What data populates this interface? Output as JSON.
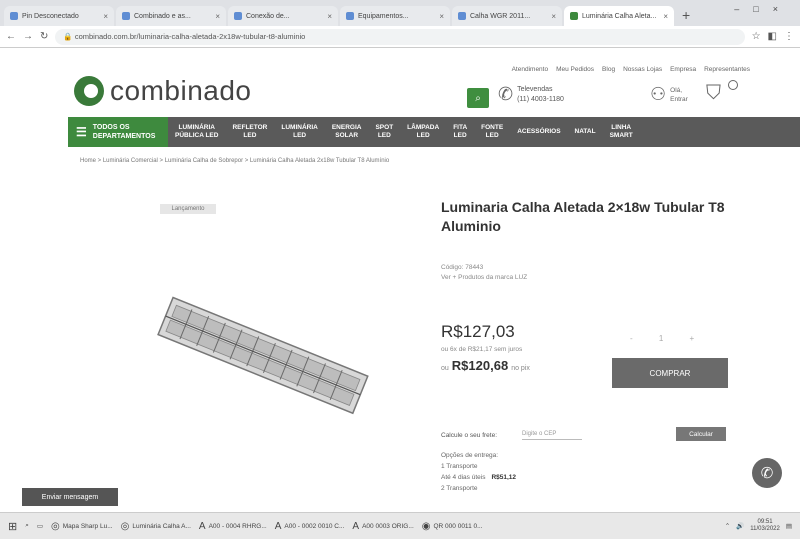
{
  "browser": {
    "tabs": [
      {
        "label": "Pin Desconectado"
      },
      {
        "label": "Combinado e as..."
      },
      {
        "label": "Conexão de..."
      },
      {
        "label": "Equipamentos..."
      },
      {
        "label": "Calha WGR 2011..."
      },
      {
        "label": "Luminária Calha Aleta...",
        "active": true
      }
    ],
    "new_tab": "+",
    "url": "combinado.com.br/luminaria-calha-aletada-2x18w-tubular-t8-aluminio"
  },
  "site": {
    "logo_text": "combinado",
    "top_links": [
      "Atendimento",
      "Meu Pedidos",
      "Blog",
      "Nossas Lojas",
      "Empresa",
      "Representantes"
    ],
    "search_icon": "search-icon",
    "phone_label": "Televendas",
    "phone_number": "(11) 4003-1180",
    "account_line1": "Olá,",
    "account_line2": "Entrar",
    "nav_all_1": "TODOS OS",
    "nav_all_2": "DEPARTAMENTOS",
    "nav_items": [
      {
        "l1": "LUMINÁRIA",
        "l2": "PÚBLICA LED"
      },
      {
        "l1": "REFLETOR",
        "l2": "LED"
      },
      {
        "l1": "LUMINÁRIA",
        "l2": "LED"
      },
      {
        "l1": "ENERGIA",
        "l2": "SOLAR"
      },
      {
        "l1": "SPOT",
        "l2": "LED"
      },
      {
        "l1": "LÂMPADA",
        "l2": "LED"
      },
      {
        "l1": "FITA",
        "l2": "LED"
      },
      {
        "l1": "FONTE",
        "l2": "LED"
      },
      {
        "l1": "ACESSÓRIOS",
        "l2": ""
      },
      {
        "l1": "NATAL",
        "l2": ""
      },
      {
        "l1": "LINHA",
        "l2": "SMART"
      }
    ],
    "breadcrumb": "Home  >  Luminária Comercial  >  Luminária Calha de Sobrepor  >  Luminária Calha Aletada 2x18w Tubular T8 Alumínio"
  },
  "product": {
    "badge": "Lançamento",
    "title": "Luminaria Calha Aletada 2×18w Tubular T8 Aluminio",
    "sku": "Código: 78443",
    "availability": "Ver + Produtos da marca LUZ",
    "price": "R$127,03",
    "installments": "ou 6x de R$21,17 sem juros",
    "pix_prefix": "ou",
    "pix_price": "R$120,68",
    "pix_suffix": "no pix",
    "qty": "-  1  +",
    "buy_label": "COMPRAR"
  },
  "shipping": {
    "label": "Calcule o seu frete:",
    "placeholder": "Digite o CEP",
    "button": "Calcular",
    "results_title": "Opções de entrega:",
    "options": [
      {
        "name": "1 Transporte",
        "detail": "Até 4 dias úteis",
        "price": "R$51,12"
      },
      {
        "name": "2 Transporte",
        "detail": "",
        "price": ""
      }
    ]
  },
  "chat_label": "Enviar mensagem",
  "taskbar": {
    "items": [
      {
        "label": "Mapa Sharp Lu..."
      },
      {
        "label": "Luminária Calha A..."
      },
      {
        "label": "A00 - 0004 RHRG..."
      },
      {
        "label": "A00 - 0002 0010 C..."
      },
      {
        "label": "A00 0003 ORIG..."
      },
      {
        "label": "QR 000 0011 0..."
      }
    ],
    "time": "09:51",
    "date": "11/03/2022"
  }
}
